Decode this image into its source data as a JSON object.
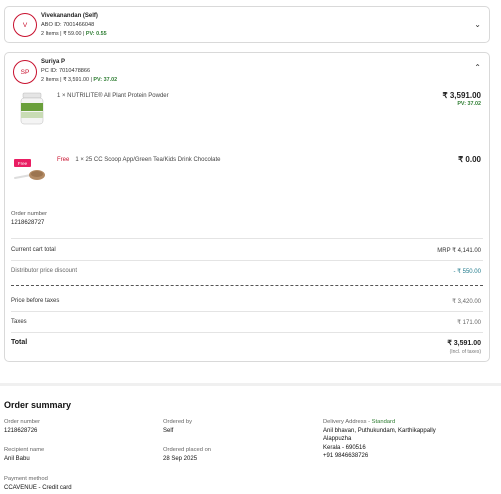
{
  "card1": {
    "avatar": "V",
    "name": "Vivekanandan (Self)",
    "abo": "ABO ID: 7001466048",
    "meta_prefix": "2 Items | ₹ 59.00 | ",
    "pv": "PV: 0.55"
  },
  "card2": {
    "avatar": "SP",
    "name": "Suriya P",
    "pc": "PC ID: 7010478866",
    "meta_prefix": "2 Items | ₹ 3,591.00 | ",
    "pv": "PV: 37.02",
    "items": [
      {
        "name": "1 × NUTRILITE® All Plant Protein Powder",
        "price": "₹ 3,591.00",
        "pv": "PV: 37.02"
      },
      {
        "free_badge": "Free",
        "free_label": "Free",
        "name": "1 × 25 CC Scoop App/Green Tea/Kids Drink Chocolate",
        "price": "₹ 0.00"
      }
    ],
    "order_number_label": "Order number",
    "order_number": "1218628727",
    "rows": {
      "current_cart_label": "Current cart total",
      "current_cart_value": "MRP ₹ 4,141.00",
      "distributor_label": "Distributor price discount",
      "distributor_value": "- ₹ 550.00",
      "before_taxes_label": "Price before taxes",
      "before_taxes_value": "₹ 3,420.00",
      "taxes_label": "Taxes",
      "taxes_value": "₹ 171.00",
      "total_label": "Total",
      "total_value": "₹ 3,591.00",
      "incl": "(Incl. of taxes)"
    }
  },
  "summary": {
    "title": "Order summary",
    "order_number_label": "Order number",
    "order_number": "1218628726",
    "ordered_by_label": "Ordered by",
    "ordered_by": "Self",
    "delivery_label": "Delivery Address - ",
    "delivery_type": "Standard",
    "address_line1": "Anil bhavan, Puthukundam, Karthikappally",
    "address_line2": "Alappuzha",
    "address_line3": "Kerala - 690516",
    "phone": "+91 9846638726",
    "recipient_label": "Recipient name",
    "recipient": "Anil Babu",
    "placed_on_label": "Ordered placed on",
    "placed_on": "28 Sep 2025",
    "payment_label": "Payment method",
    "payment": "CCAVENUE - Credit card"
  }
}
